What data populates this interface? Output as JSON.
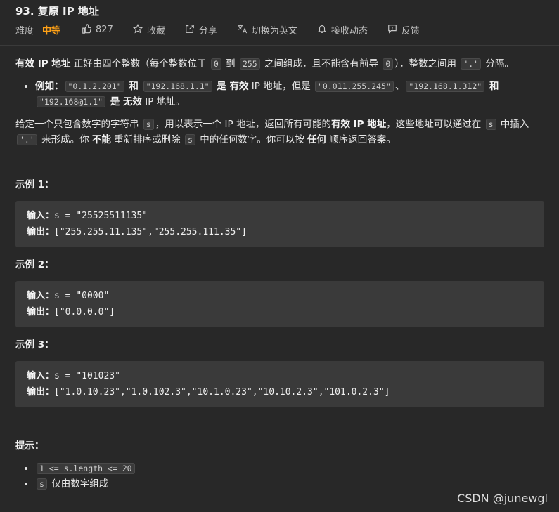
{
  "problem": {
    "title": "93. 复原 IP 地址",
    "difficulty_label": "难度",
    "difficulty": "中等",
    "likes": "827",
    "collect": "收藏",
    "share": "分享",
    "translate": "切换为英文",
    "subscribe": "接收动态",
    "feedback": "反馈"
  },
  "desc": {
    "p1_a": "有效 IP 地址",
    "p1_b": " 正好由四个整数（每个整数位于 ",
    "p1_c": "0",
    "p1_d": " 到 ",
    "p1_e": "255",
    "p1_f": " 之间组成，且不能含有前导 ",
    "p1_g": "0",
    "p1_h": "），整数之间用 ",
    "p1_i": "'.'",
    "p1_j": " 分隔。",
    "li_a": "例如：",
    "li_b": "\"0.1.2.201\"",
    "li_c": " 和 ",
    "li_d": "\"192.168.1.1\"",
    "li_e": " 是 ",
    "li_f": "有效",
    "li_g": " IP 地址，但是 ",
    "li_h": "\"0.011.255.245\"",
    "li_i": "、",
    "li_j": "\"192.168.1.312\"",
    "li_k": " 和 ",
    "li_l": "\"192.168@1.1\"",
    "li_m": " 是 ",
    "li_n": "无效",
    "li_o": " IP 地址。",
    "p2_a": "给定一个只包含数字的字符串 ",
    "p2_b": "s",
    "p2_c": "，用以表示一个 IP 地址，返回所有可能的",
    "p2_d": "有效 IP 地址",
    "p2_e": "，这些地址可以通过在 ",
    "p2_f": "s",
    "p2_g": " 中插入 ",
    "p2_h": "'.'",
    "p2_i": " 来形成。你 ",
    "p2_j": "不能",
    "p2_k": " 重新排序或删除 ",
    "p2_l": "s",
    "p2_m": " 中的任何数字。你可以按 ",
    "p2_n": "任何",
    "p2_o": " 顺序返回答案。"
  },
  "examples": [
    {
      "heading": "示例 1：",
      "in_label": "输入：",
      "in": "s = \"25525511135\"",
      "out_label": "输出：",
      "out": "[\"255.255.11.135\",\"255.255.111.35\"]"
    },
    {
      "heading": "示例 2：",
      "in_label": "输入：",
      "in": "s = \"0000\"",
      "out_label": "输出：",
      "out": "[\"0.0.0.0\"]"
    },
    {
      "heading": "示例 3：",
      "in_label": "输入：",
      "in": "s = \"101023\"",
      "out_label": "输出：",
      "out": "[\"1.0.10.23\",\"1.0.102.3\",\"10.1.0.23\",\"10.10.2.3\",\"101.0.2.3\"]"
    }
  ],
  "hints": {
    "heading": "提示：",
    "h1_code": "1 <= s.length <= 20",
    "h2_code": "s",
    "h2_text": " 仅由数字组成"
  },
  "watermark": "CSDN @junewgl",
  "colors": {
    "accent": "#ffa116",
    "background": "#282828",
    "code_bg": "#3a3a3a"
  },
  "icons": [
    "thumbs-up-icon",
    "star-icon",
    "share-icon",
    "translate-icon",
    "bell-icon",
    "feedback-icon"
  ]
}
